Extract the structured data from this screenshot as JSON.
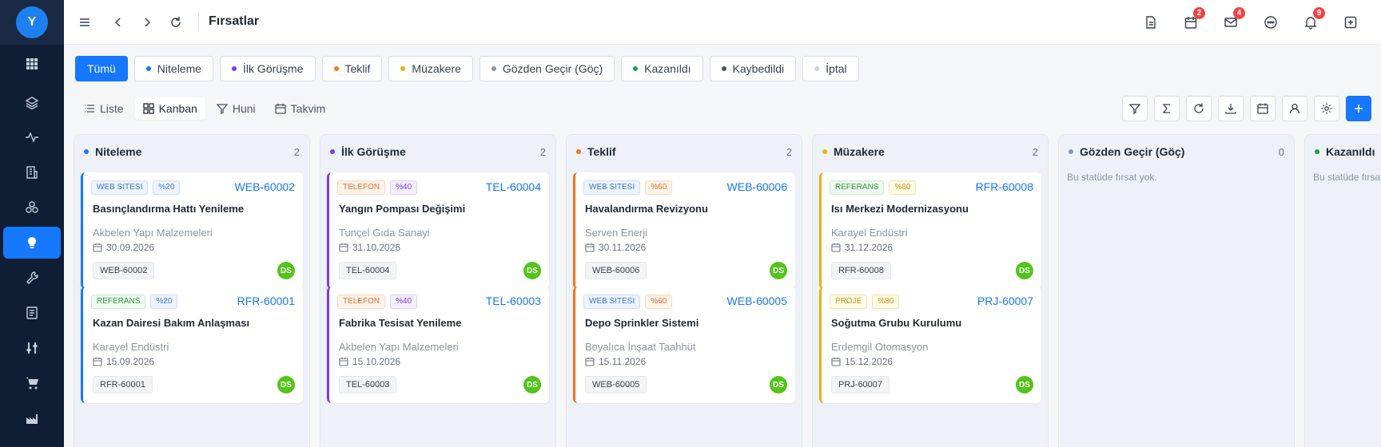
{
  "sidebar": {
    "user_initial": "Y",
    "items": [
      {
        "icon": "grid-icon"
      },
      {
        "icon": "layers-icon"
      },
      {
        "icon": "activity-icon"
      },
      {
        "icon": "building-icon"
      },
      {
        "icon": "cubes-icon"
      },
      {
        "icon": "lightbulb-icon",
        "active": true
      },
      {
        "icon": "wrench-icon"
      },
      {
        "icon": "document-icon"
      },
      {
        "icon": "sliders-icon"
      },
      {
        "icon": "cart-icon"
      },
      {
        "icon": "factory-icon"
      }
    ]
  },
  "header": {
    "title": "Fırsatlar",
    "badges": {
      "calendar": "2",
      "mail": "4",
      "notifications": "9"
    }
  },
  "filters": [
    {
      "label": "Tümü",
      "active": true,
      "color": ""
    },
    {
      "label": "Niteleme",
      "color": "#1677ff"
    },
    {
      "label": "İlk Görüşme",
      "color": "#7c3aed"
    },
    {
      "label": "Teklif",
      "color": "#f97316"
    },
    {
      "label": "Müzakere",
      "color": "#eab308"
    },
    {
      "label": "Gözden Geçir (Göç)",
      "color": "#8c94a8"
    },
    {
      "label": "Kazanıldı",
      "color": "#16a34a"
    },
    {
      "label": "Kaybedildi",
      "color": "#475569"
    },
    {
      "label": "İptal",
      "color": "#cbd5e1"
    }
  ],
  "views": [
    {
      "label": "Liste",
      "icon": "list-icon"
    },
    {
      "label": "Kanban",
      "icon": "kanban-icon",
      "active": true
    },
    {
      "label": "Huni",
      "icon": "funnel-icon"
    },
    {
      "label": "Takvim",
      "icon": "calendar-icon"
    }
  ],
  "tools": [
    "filter-icon",
    "sigma-icon",
    "refresh-icon",
    "download-icon",
    "calendar-icon",
    "user-icon",
    "settings-icon",
    "plus-icon"
  ],
  "columns": [
    {
      "title": "Niteleme",
      "count": "2",
      "color": "#1677ff",
      "cards": [
        {
          "tags": [
            {
              "text": "WEB SITESI",
              "kind": "web"
            },
            {
              "text": "%20",
              "kind": "pct20"
            }
          ],
          "code": "WEB-60002",
          "title": "Basınçlandırma Hattı Yenileme",
          "company": "Akbelen Yapı Malzemeleri",
          "date": "30.09.2026",
          "ref": "WEB-60002",
          "owner": "DS"
        },
        {
          "tags": [
            {
              "text": "REFERANS",
              "kind": "ref"
            },
            {
              "text": "%20",
              "kind": "pct20"
            }
          ],
          "code": "RFR-60001",
          "title": "Kazan Dairesi Bakım Anlaşması",
          "company": "Karayel Endüstri",
          "date": "15.09.2026",
          "ref": "RFR-60001",
          "owner": "DS"
        }
      ]
    },
    {
      "title": "İlk Görüşme",
      "count": "2",
      "color": "#7c3aed",
      "cards": [
        {
          "tags": [
            {
              "text": "TELEFON",
              "kind": "tel"
            },
            {
              "text": "%40",
              "kind": "pct40"
            }
          ],
          "code": "TEL-60004",
          "title": "Yangın Pompası Değişimi",
          "company": "Tunçel Gıda Sanayi",
          "date": "31.10.2026",
          "ref": "TEL-60004",
          "owner": "DS"
        },
        {
          "tags": [
            {
              "text": "TELEFON",
              "kind": "tel"
            },
            {
              "text": "%40",
              "kind": "pct40"
            }
          ],
          "code": "TEL-60003",
          "title": "Fabrika Tesisat Yenileme",
          "company": "Akbelen Yapı Malzemeleri",
          "date": "15.10.2026",
          "ref": "TEL-60003",
          "owner": "DS"
        }
      ]
    },
    {
      "title": "Teklif",
      "count": "2",
      "color": "#f97316",
      "cards": [
        {
          "tags": [
            {
              "text": "WEB SITESI",
              "kind": "web"
            },
            {
              "text": "%60",
              "kind": "pct60"
            }
          ],
          "code": "WEB-60006",
          "title": "Havalandırma Revizyonu",
          "company": "Serven Enerji",
          "date": "30.11.2026",
          "ref": "WEB-60006",
          "owner": "DS"
        },
        {
          "tags": [
            {
              "text": "WEB SITESI",
              "kind": "web"
            },
            {
              "text": "%60",
              "kind": "pct60"
            }
          ],
          "code": "WEB-60005",
          "title": "Depo Sprinkler Sistemi",
          "company": "Boyalıca İnşaat Taahhüt",
          "date": "15.11.2026",
          "ref": "WEB-60005",
          "owner": "DS"
        }
      ]
    },
    {
      "title": "Müzakere",
      "count": "2",
      "color": "#eab308",
      "cards": [
        {
          "tags": [
            {
              "text": "REFERANS",
              "kind": "ref"
            },
            {
              "text": "%80",
              "kind": "pct80"
            }
          ],
          "code": "RFR-60008",
          "title": "Isı Merkezi Modernizasyonu",
          "company": "Karayel Endüstri",
          "date": "31.12.2026",
          "ref": "RFR-60008",
          "owner": "DS"
        },
        {
          "tags": [
            {
              "text": "PROJE",
              "kind": "proj"
            },
            {
              "text": "%80",
              "kind": "pct80"
            }
          ],
          "code": "PRJ-60007",
          "title": "Soğutma Grubu Kurulumu",
          "company": "Erdemgil Otomasyon",
          "date": "15.12.2026",
          "ref": "PRJ-60007",
          "owner": "DS"
        }
      ]
    },
    {
      "title": "Gözden Geçir (Göç)",
      "count": "0",
      "color": "#8c94a8",
      "empty_text": "Bu statüde fırsat yok.",
      "cards": []
    },
    {
      "title": "Kazanıldı",
      "count": "",
      "color": "#16a34a",
      "empty_text": "Bu statüde fırsat yok.",
      "cards": []
    }
  ]
}
